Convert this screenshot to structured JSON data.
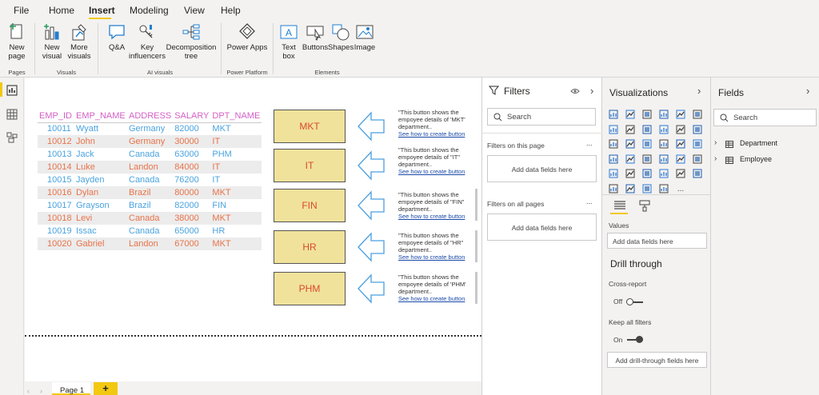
{
  "menu": {
    "items": [
      "File",
      "Home",
      "Insert",
      "Modeling",
      "View",
      "Help"
    ],
    "active": "Insert"
  },
  "ribbon": {
    "pages": {
      "new_page": "New page",
      "group": "Pages"
    },
    "visuals": {
      "new_visual": "New visual",
      "more_visuals": "More visuals",
      "group": "Visuals"
    },
    "ai": {
      "qa": "Q&A",
      "key_influencers": "Key influencers",
      "decomposition_tree": "Decomposition tree",
      "group": "AI visuals"
    },
    "power": {
      "power_apps": "Power Apps",
      "group": "Power Platform"
    },
    "elements": {
      "text_box": "Text box",
      "buttons": "Buttons",
      "shapes": "Shapes",
      "image": "Image",
      "group": "Elements"
    }
  },
  "table": {
    "headers": [
      "EMP_ID",
      "EMP_NAME",
      "ADDRESS",
      "SALARY",
      "DPT_NAME"
    ],
    "rows": [
      [
        "10011",
        "Wyatt",
        "Germany",
        "82000",
        "MKT"
      ],
      [
        "10012",
        "John",
        "Germany",
        "30000",
        "IT"
      ],
      [
        "10013",
        "Jack",
        "Canada",
        "63000",
        "PHM"
      ],
      [
        "10014",
        "Luke",
        "Landon",
        "84000",
        "IT"
      ],
      [
        "10015",
        "Jayden",
        "Canada",
        "76200",
        "IT"
      ],
      [
        "10016",
        "Dylan",
        "Brazil",
        "80000",
        "MKT"
      ],
      [
        "10017",
        "Grayson",
        "Brazil",
        "82000",
        "FIN"
      ],
      [
        "10018",
        "Levi",
        "Canada",
        "38000",
        "MKT"
      ],
      [
        "10019",
        "Issac",
        "Canada",
        "65000",
        "HR"
      ],
      [
        "10020",
        "Gabriel",
        "Landon",
        "67000",
        "MKT"
      ]
    ]
  },
  "dept_buttons": [
    {
      "label": "MKT",
      "line1": "\"This button shows the",
      "line2": "empoyee details of 'MKT'",
      "line3": "department..",
      "link": "See how to create button"
    },
    {
      "label": "IT",
      "line1": "\"This button shows the",
      "line2": "empoyee details of \"IT\"",
      "line3": "department..",
      "link": "See how to create button"
    },
    {
      "label": "FIN",
      "line1": "\"This button shows the",
      "line2": "empoyee details of \"FIN\"",
      "line3": "department..",
      "link": "See how to create button"
    },
    {
      "label": "HR",
      "line1": "\"This button shows the",
      "line2": "empoyee details of \"HR\"",
      "line3": "department..",
      "link": "See how to create button"
    },
    {
      "label": "PHM",
      "line1": "\"This button shows the",
      "line2": "empoyee details of 'PHM'",
      "line3": "department..",
      "link": "See how to create button"
    }
  ],
  "page_tabs": {
    "page1": "Page 1",
    "add": "+"
  },
  "filters": {
    "title": "Filters",
    "search_placeholder": "Search",
    "on_this_page": "Filters on this page",
    "on_all_pages": "Filters on all pages",
    "add_fields": "Add data fields here",
    "more": "..."
  },
  "visualizations": {
    "title": "Visualizations",
    "values_label": "Values",
    "values_drop": "Add data fields here",
    "drill_title": "Drill through",
    "cross_report": "Cross-report",
    "cross_state": "Off",
    "keep_filters": "Keep all filters",
    "keep_state": "On",
    "drill_drop": "Add drill-through fields here",
    "more": "..."
  },
  "fields": {
    "title": "Fields",
    "search_placeholder": "Search",
    "tables": [
      "Department",
      "Employee"
    ]
  },
  "colors": {
    "accent": "#f2c811",
    "header_text": "#d45fc6",
    "row_blue": "#4aa3df",
    "row_orange": "#e8734a",
    "button_fill": "#f0e29b",
    "button_text": "#d94a2e",
    "arrow_stroke": "#4a9fe0"
  }
}
